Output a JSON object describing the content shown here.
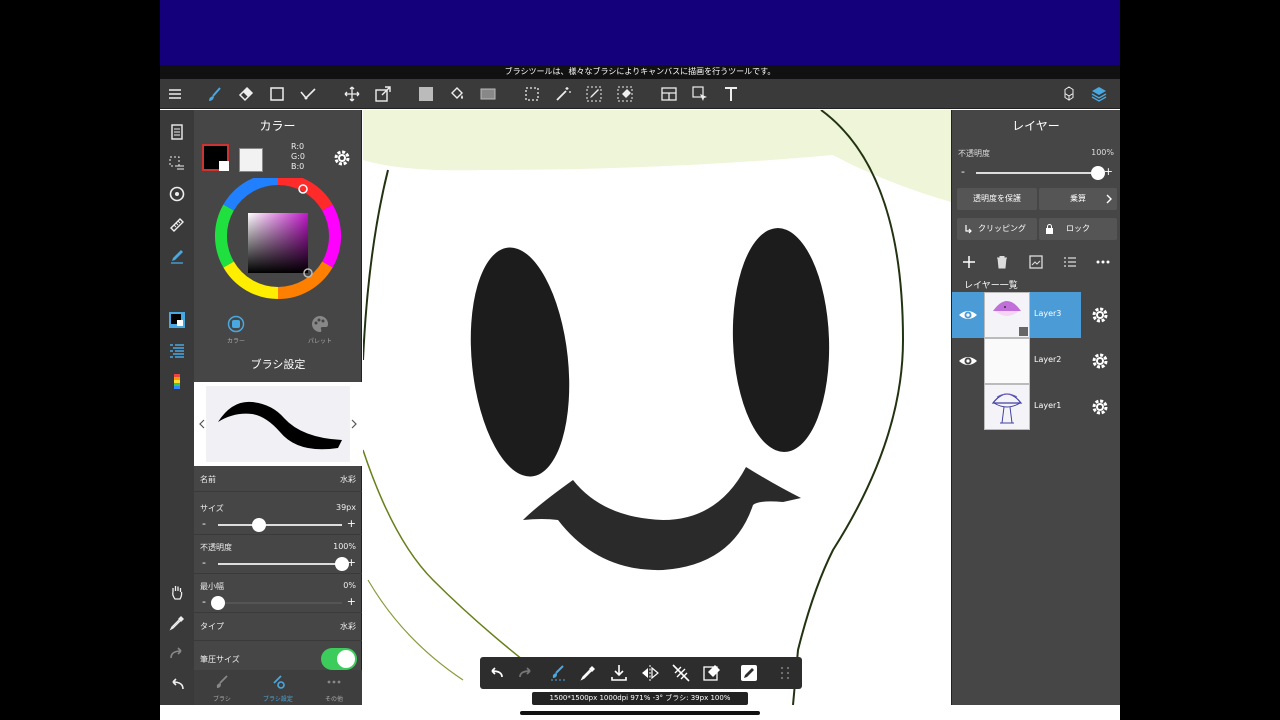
{
  "tip_text": "ブラシツールは、様々なブラシによりキャンバスに描画を行うツールです。",
  "toolbar": {
    "icons": [
      "menu-icon",
      "brush-icon",
      "eraser-icon",
      "shape-icon",
      "vector-icon",
      "move-icon",
      "transform-icon",
      "fill-color-icon",
      "bucket-icon",
      "gradient-icon",
      "select-rect-icon",
      "magic-wand-icon",
      "select-pen-icon",
      "select-eraser-icon",
      "frame-icon",
      "select-icon",
      "text-icon",
      "materials-icon",
      "layers-icon"
    ]
  },
  "color_panel": {
    "title": "カラー",
    "rgb": {
      "r": "R:0",
      "g": "G:0",
      "b": "B:0"
    },
    "tab_color": "カラー",
    "tab_palette": "パレット"
  },
  "brush_panel": {
    "title": "ブラシ設定",
    "name_label": "名前",
    "name_value": "水彩",
    "size_label": "サイズ",
    "size_value": "39px",
    "size_fraction": 0.33,
    "opacity_label": "不透明度",
    "opacity_value": "100%",
    "opacity_fraction": 1.0,
    "min_label": "最小幅",
    "min_value": "0%",
    "min_fraction": 0.0,
    "type_label": "タイプ",
    "type_value": "水彩",
    "pressure_label": "筆圧サイズ",
    "pressure_on": true,
    "tabs": [
      "ブラシ",
      "ブラシ設定",
      "その他"
    ]
  },
  "layer_panel": {
    "title": "レイヤー",
    "opacity_label": "不透明度",
    "opacity_value": "100%",
    "protect_label": "透明度を保護",
    "blend_label": "乗算",
    "clipping_label": "クリッピング",
    "lock_label": "ロック",
    "list_title": "レイヤー一覧",
    "layers": [
      {
        "name": "Layer3",
        "selected": true,
        "visible": true
      },
      {
        "name": "Layer2",
        "selected": false,
        "visible": true
      },
      {
        "name": "Layer1",
        "selected": false,
        "visible": false
      }
    ]
  },
  "status_text": "1500*1500px 1000dpi 971% -3° ブラシ: 39px 100%",
  "colors": {
    "accent": "#4a9bd6",
    "top_band": "#14007a",
    "toggle_on": "#3ccc5c",
    "foreground": "#000000",
    "background": "#ffffff"
  }
}
